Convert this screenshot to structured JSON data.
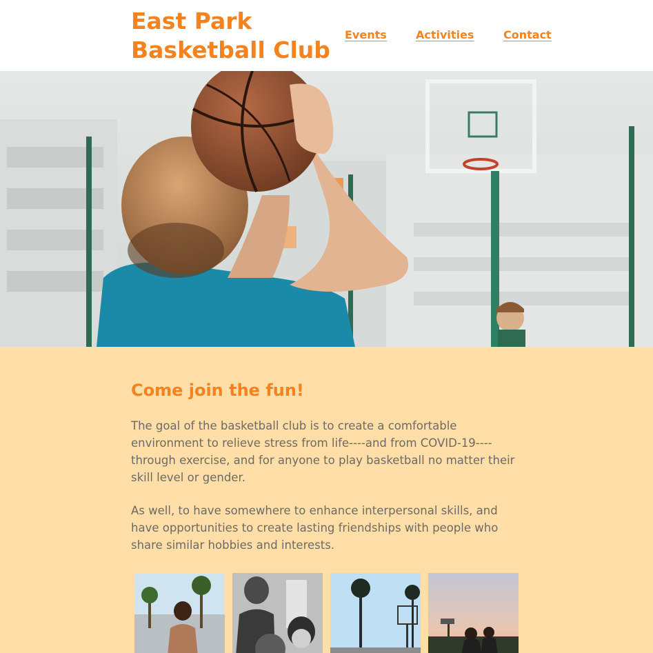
{
  "header": {
    "site_title": "East Park Basketball Club",
    "nav": [
      {
        "label": "Events"
      },
      {
        "label": "Activities"
      },
      {
        "label": "Contact"
      }
    ]
  },
  "hero": {
    "image": "basketball-player-shooting-photo"
  },
  "content": {
    "heading": "Come join the fun!",
    "paragraphs": [
      "The goal of the basketball club is to create a comfortable environment to relieve stress from life----and from COVID-19----through exercise, and for anyone to play basketball no matter their skill level or gender.",
      "As well, to have somewhere to enhance interpersonal skills, and have opportunities to create lasting friendships with people who share similar hobbies and interests."
    ],
    "gallery": [
      {
        "image": "player-dribbling-palm-trees-photo"
      },
      {
        "image": "family-with-basketball-bw-photo"
      },
      {
        "image": "palm-trees-hoop-photo"
      },
      {
        "image": "players-at-sunset-photo"
      }
    ]
  },
  "colors": {
    "accent": "#f4831f",
    "content_background": "#ffdea7",
    "body_text": "#6e6a63",
    "header_background": "#ffffff"
  }
}
